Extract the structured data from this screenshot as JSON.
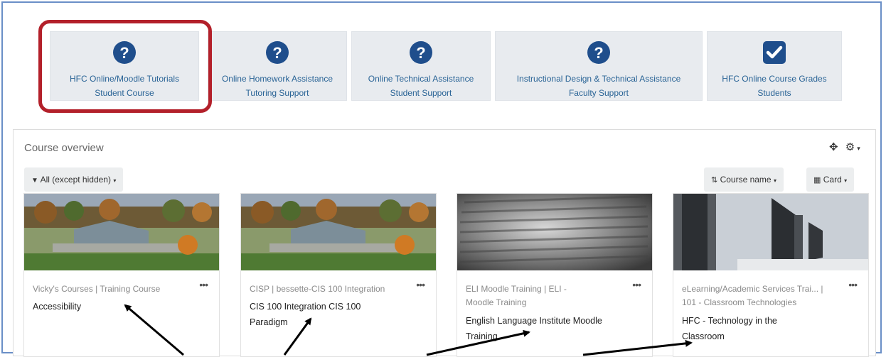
{
  "tiles": [
    {
      "line1": "HFC Online/Moodle Tutorials",
      "line2": "Student Course",
      "icon": "question-circle-icon"
    },
    {
      "line1": "Online Homework Assistance",
      "line2": "Tutoring Support",
      "icon": "question-circle-icon"
    },
    {
      "line1": "Online Technical Assistance",
      "line2": "Student Support",
      "icon": "question-circle-icon"
    },
    {
      "line1": "Instructional Design & Technical Assistance",
      "line2": "Faculty Support",
      "icon": "question-circle-icon"
    },
    {
      "line1": "HFC Online Course Grades",
      "line2": "Students",
      "icon": "checkbox-checked-icon"
    }
  ],
  "overview": {
    "title": "Course overview",
    "filter_label": "All (except hidden)",
    "sort_label": "Course name",
    "view_label": "Card"
  },
  "cards": [
    {
      "category": "Vicky's Courses | Training Course",
      "name": "Accessibility",
      "image": "campus-photo"
    },
    {
      "category": "CISP | bessette-CIS 100 Integration",
      "name": "CIS 100 Integration CIS 100 Paradigm",
      "image": "campus-photo"
    },
    {
      "category": "ELI Moodle Training | ELI - Moodle Training",
      "name": "English Language Institute Moodle Training",
      "image": "dictionary-photo"
    },
    {
      "category": "eLearning/Academic Services Trai... | 101 - Classroom Technologies",
      "name": "HFC - Technology in the Classroom",
      "image": "computer-photo"
    }
  ],
  "colors": {
    "accent": "#1f4e8c",
    "highlight": "#b3202a",
    "frame": "#6a8fc7",
    "tile_bg": "#e8ebef"
  }
}
